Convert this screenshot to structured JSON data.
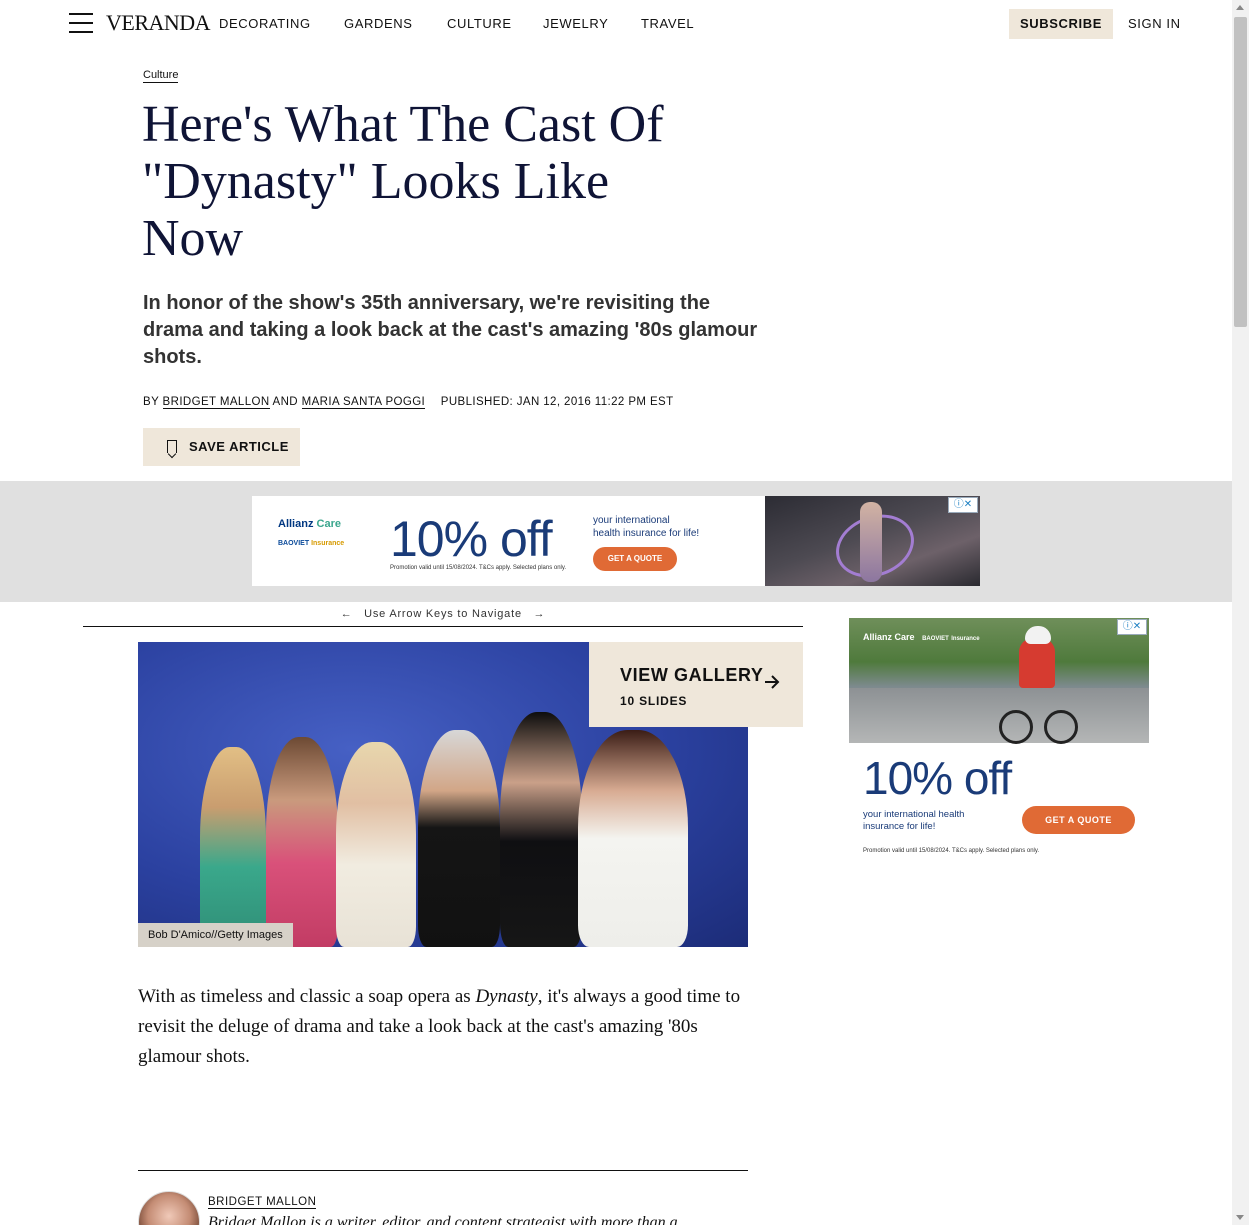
{
  "header": {
    "logo": "VERANDA",
    "nav": [
      "DECORATING",
      "GARDENS",
      "CULTURE",
      "JEWELRY",
      "TRAVEL"
    ],
    "subscribe_label": "SUBSCRIBE",
    "signin_label": "SIGN IN"
  },
  "article": {
    "category": "Culture",
    "headline_lines": [
      "Here's What The Cast Of",
      "\"Dynasty\" Looks Like",
      "Now"
    ],
    "dek": "In honor of the show's 35th anniversary, we're revisiting the drama and taking a look back at the cast's amazing '80s glamour shots.",
    "byline_prefix": "BY",
    "author_1": "BRIDGET MALLON",
    "byline_and": "AND",
    "author_2": "MARIA SANTA POGGI",
    "published": "PUBLISHED: JAN 12, 2016 11:22 PM EST",
    "save_label": "SAVE ARTICLE",
    "arrow_nav": "Use Arrow Keys to Navigate",
    "image_credit": "Bob D'Amico//Getty Images",
    "gallery_title": "VIEW GALLERY",
    "gallery_count": "10 SLIDES",
    "body_pre": "With as timeless and classic a soap opera as ",
    "body_italic": "Dynasty",
    "body_post": ", it's always a good time to revisit the deluge of drama and take a look back at the cast's amazing '80s glamour shots.",
    "author_card_name": "BRIDGET MALLON",
    "author_card_bio": "Bridget Mallon is a writer, editor, and content strategist with more than a"
  },
  "ads": {
    "top": {
      "brand_1": "Allianz",
      "brand_1b": "Care",
      "brand_2": "BAOVIET",
      "brand_2b": "Insurance",
      "offer": "10% off",
      "tagline_1": "your international",
      "tagline_2": "health insurance for life!",
      "cta": "GET A QUOTE",
      "promo": "Promotion valid until 15/08/2024. T&Cs apply. Selected plans only."
    },
    "right": {
      "brand_1": "Allianz",
      "brand_1b": "Care",
      "brand_2": "BAOVIET",
      "brand_2b": "Insurance",
      "offer": "10% off",
      "tagline_1": "your international health",
      "tagline_2": "insurance for life!",
      "cta": "GET A QUOTE",
      "promo": "Promotion valid until 15/08/2024. T&Cs apply. Selected plans only."
    },
    "choices_label": "ⓘ✕"
  },
  "colors": {
    "accent_beige": "#efe7da",
    "headline_navy": "#0f1436",
    "ad_orange": "#e06a35",
    "ad_blue": "#1a3b78"
  }
}
